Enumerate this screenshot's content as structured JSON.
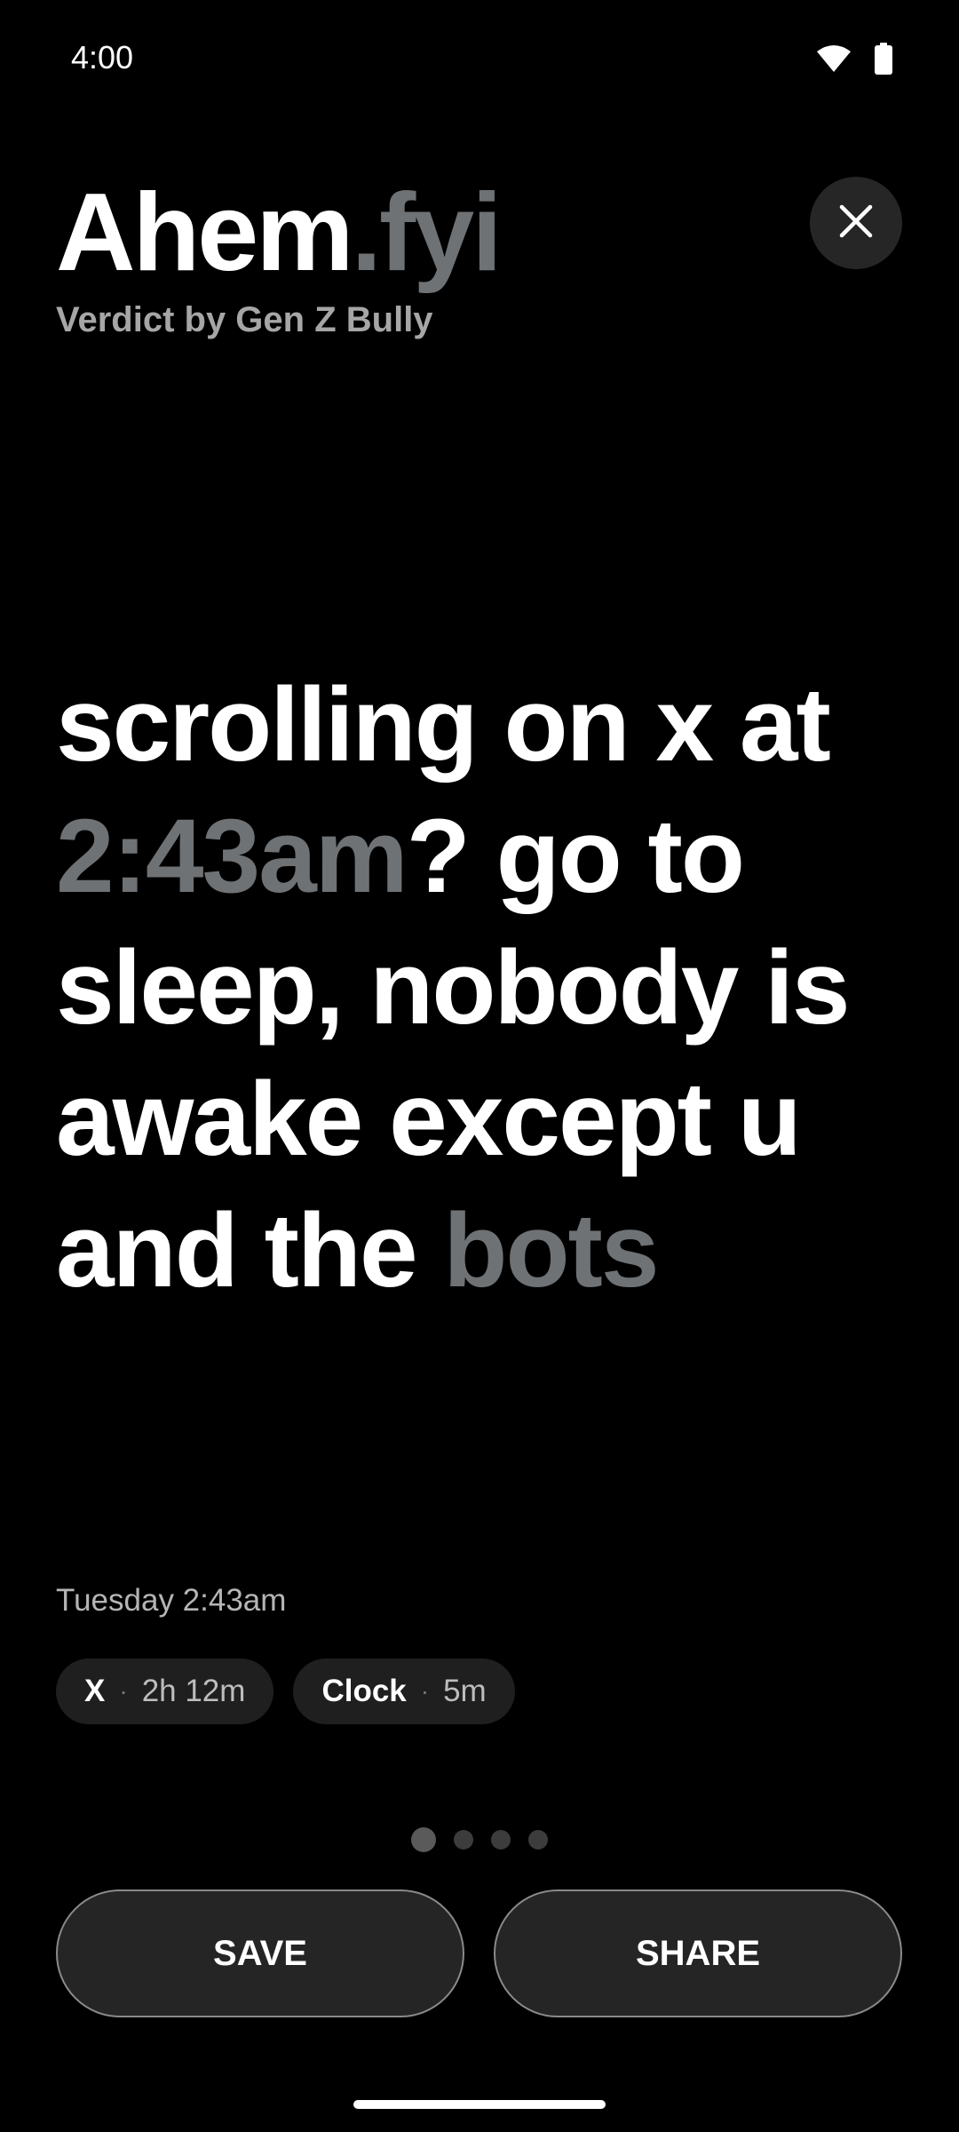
{
  "status_bar": {
    "time": "4:00",
    "icons": [
      "wifi-icon",
      "battery-icon"
    ]
  },
  "header": {
    "brand_main": "Ahem",
    "brand_accent": ".fyi",
    "subtitle": "Verdict by Gen Z Bully",
    "close_icon": "close-icon"
  },
  "verdict": {
    "part1": "scrolling on x at ",
    "highlight1": "2:43am",
    "part2": "? go to sleep, nobody is awake except u and the ",
    "highlight2": "bots"
  },
  "session": {
    "timestamp": "Tuesday 2:43am",
    "usage": [
      {
        "app": "X",
        "duration": "2h 12m"
      },
      {
        "app": "Clock",
        "duration": "5m"
      }
    ]
  },
  "pager": {
    "pages": 4,
    "current": 1
  },
  "actions": {
    "save_label": "SAVE",
    "share_label": "SHARE"
  },
  "colors": {
    "background": "#000000",
    "accent_gray": "#6f7275",
    "chip_bg": "#1f1f1f",
    "button_bg": "#252525"
  }
}
